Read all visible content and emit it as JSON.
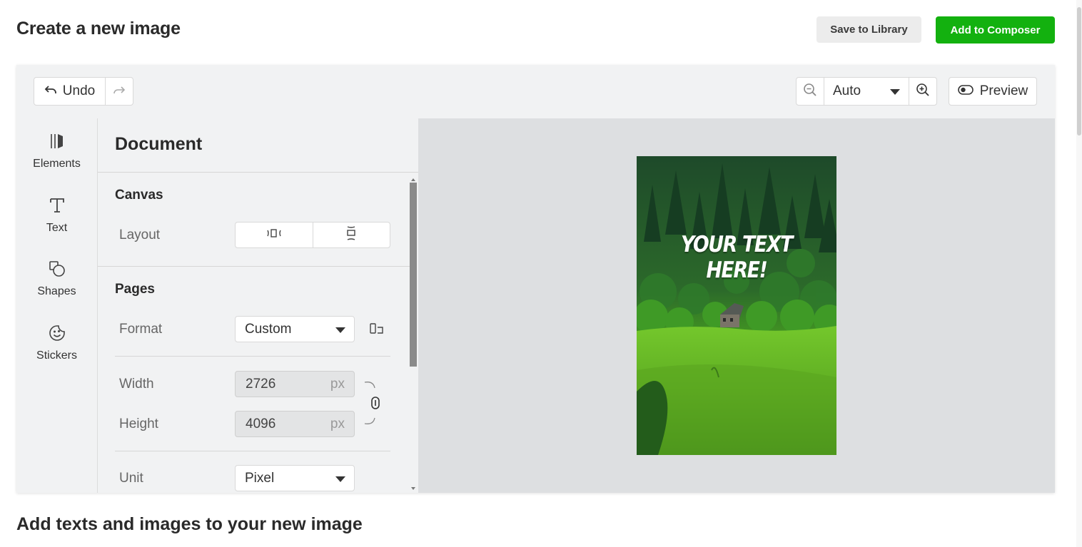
{
  "header": {
    "title": "Create a new image",
    "save_label": "Save to Library",
    "add_label": "Add to Composer"
  },
  "toolbar": {
    "undo_label": "Undo",
    "zoom_value": "Auto",
    "preview_label": "Preview"
  },
  "rail": {
    "items": [
      {
        "label": "Elements",
        "icon": "elements-icon"
      },
      {
        "label": "Text",
        "icon": "text-icon"
      },
      {
        "label": "Shapes",
        "icon": "shapes-icon"
      },
      {
        "label": "Stickers",
        "icon": "stickers-icon"
      }
    ]
  },
  "panel": {
    "title": "Document",
    "canvas": {
      "section_label": "Canvas",
      "layout_label": "Layout"
    },
    "pages": {
      "section_label": "Pages",
      "format_label": "Format",
      "format_value": "Custom",
      "width_label": "Width",
      "width_value": "2726",
      "height_label": "Height",
      "height_value": "4096",
      "unit_suffix": "px",
      "unit_label": "Unit",
      "unit_value": "Pixel"
    }
  },
  "canvas": {
    "text": "YOUR TEXT HERE!"
  },
  "footer": {
    "subtitle": "Add texts and images to your new image"
  },
  "colors": {
    "accent_green": "#13b10f",
    "canvas_bg": "#dddfe1"
  }
}
